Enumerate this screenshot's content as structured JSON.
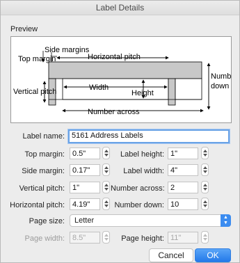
{
  "window": {
    "title": "Label Details"
  },
  "preview": {
    "section_label": "Preview",
    "side_margins": "Side margins",
    "horizontal_pitch": "Horizontal pitch",
    "top_margin": "Top margin",
    "vertical_pitch": "Vertical pitch",
    "width": "Width",
    "height": "Height",
    "number_down_line1": "Number",
    "number_down_line2": "down",
    "number_across": "Number across"
  },
  "form": {
    "label_name": {
      "label": "Label name:",
      "value": "5161 Address Labels"
    },
    "top_margin": {
      "label": "Top margin:",
      "value": "0.5\""
    },
    "side_margin": {
      "label": "Side margin:",
      "value": "0.17\""
    },
    "vertical_pitch": {
      "label": "Vertical pitch:",
      "value": "1\""
    },
    "horizontal_pitch": {
      "label": "Horizontal pitch:",
      "value": "4.19\""
    },
    "label_height": {
      "label": "Label height:",
      "value": "1\""
    },
    "label_width": {
      "label": "Label width:",
      "value": "4\""
    },
    "number_across": {
      "label": "Number across:",
      "value": "2"
    },
    "number_down": {
      "label": "Number down:",
      "value": "10"
    },
    "page_size": {
      "label": "Page size:",
      "value": "Letter"
    },
    "page_width": {
      "label": "Page width:",
      "value": "8.5\""
    },
    "page_height": {
      "label": "Page height:",
      "value": "11\""
    }
  },
  "buttons": {
    "cancel": "Cancel",
    "ok": "OK"
  },
  "colors": {
    "accent": "#2379e9",
    "focus_ring": "#6aa3e6",
    "label_fill": "#c8c8c8"
  }
}
